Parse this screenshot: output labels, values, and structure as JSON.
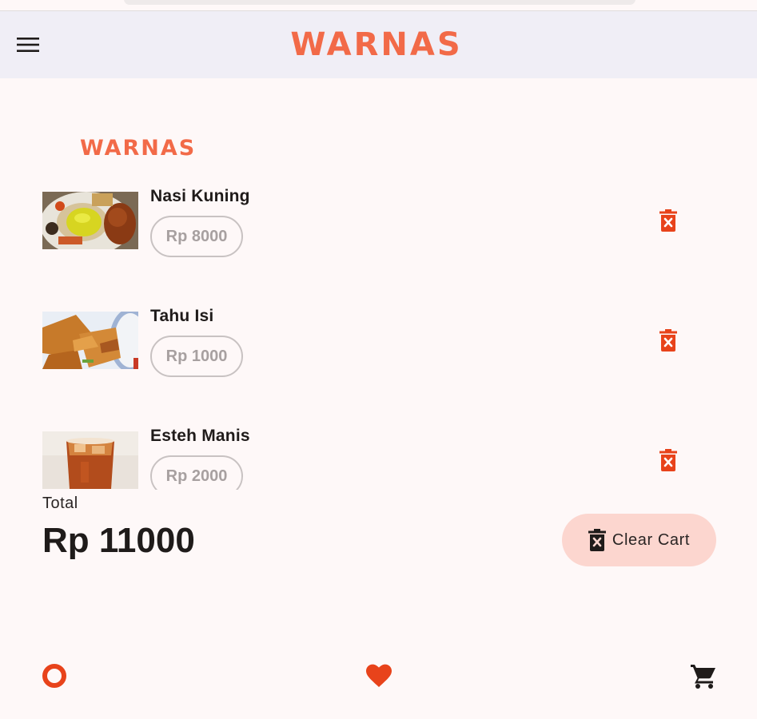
{
  "app": {
    "logo_text": "WARNAS"
  },
  "colors": {
    "accent": "#f26a48",
    "danger": "#e8431b",
    "clear_bg": "#fcd6cf",
    "appbar_bg": "#f0eef6"
  },
  "header": {
    "menu_icon": "hamburger-menu-icon"
  },
  "cart": {
    "items": [
      {
        "name": "Nasi Kuning",
        "price": "Rp 8000",
        "image": "nasi-kuning-photo"
      },
      {
        "name": "Tahu Isi",
        "price": "Rp 1000",
        "image": "tahu-isi-photo"
      },
      {
        "name": "Esteh Manis",
        "price": "Rp 2000",
        "image": "esteh-manis-photo"
      }
    ],
    "total_label": "Total",
    "total_value": "Rp 11000",
    "clear_label": "Clear Cart"
  },
  "bottom_nav": {
    "items": [
      "home-ring-icon",
      "favorite-heart-icon",
      "cart-icon"
    ]
  }
}
